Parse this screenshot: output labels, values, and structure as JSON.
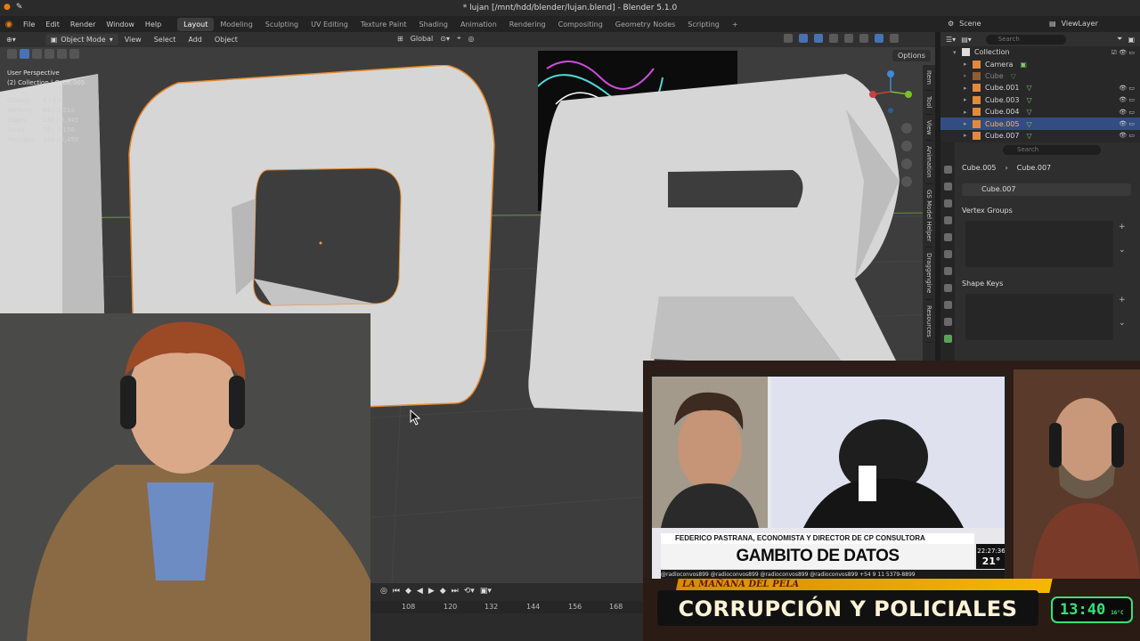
{
  "window": {
    "title": "* lujan [/mnt/hdd/blender/lujan.blend] - Blender 5.1.0"
  },
  "menubar": {
    "items": [
      "File",
      "Edit",
      "Render",
      "Window",
      "Help"
    ],
    "workspaces": [
      "Layout",
      "Modeling",
      "Sculpting",
      "UV Editing",
      "Texture Paint",
      "Shading",
      "Animation",
      "Rendering",
      "Compositing",
      "Geometry Nodes",
      "Scripting"
    ],
    "active_workspace": "Layout",
    "add_tab": "+",
    "scene": "Scene",
    "view_layer": "ViewLayer"
  },
  "viewport_header": {
    "mode": "Object Mode",
    "menus": [
      "View",
      "Select",
      "Add",
      "Object"
    ],
    "orientation": "Global",
    "options": "Options"
  },
  "viewport": {
    "perspective": "User Perspective",
    "collection_path": "(2) Collection | Cube.005",
    "stats": [
      {
        "label": "Objects",
        "value": "1 / 12"
      },
      {
        "label": "Vertices",
        "value": "64 / 1,214"
      },
      {
        "label": "Edges",
        "value": "136 / 2,345"
      },
      {
        "label": "Faces",
        "value": "72 / 1,150"
      },
      {
        "label": "Triangles",
        "value": "128 / 2,458"
      }
    ],
    "side_tabs": [
      "Item",
      "Tool",
      "View",
      "Animation",
      "GS Model Helper",
      "Draggengine",
      "Resources"
    ],
    "colors": {
      "background": "#3d3d3d",
      "selected_outline": "#e8892b",
      "mesh": "#dcdcdc"
    }
  },
  "timeline": {
    "ruler": [
      "108",
      "120",
      "132",
      "144",
      "156",
      "168"
    ]
  },
  "outliner": {
    "search_placeholder": "Search",
    "rows": [
      {
        "name": "Collection",
        "type": "collection",
        "selected": false
      },
      {
        "name": "Camera",
        "type": "camera",
        "selected": false
      },
      {
        "name": "Cube",
        "type": "mesh",
        "selected": false
      },
      {
        "name": "Cube.001",
        "type": "mesh",
        "selected": false
      },
      {
        "name": "Cube.003",
        "type": "mesh",
        "selected": false
      },
      {
        "name": "Cube.004",
        "type": "mesh",
        "selected": false
      },
      {
        "name": "Cube.005",
        "type": "mesh",
        "selected": true
      },
      {
        "name": "Cube.007",
        "type": "mesh",
        "selected": false
      }
    ]
  },
  "properties": {
    "search_placeholder": "Search",
    "breadcrumb_object": "Cube.005",
    "breadcrumb_mesh": "Cube.007",
    "mesh_name": "Cube.007",
    "panels": [
      "Vertex Groups",
      "Shape Keys"
    ]
  },
  "stream": {
    "tv_name_bar": "FEDERICO PASTRANA, ECONOMISTA Y DIRECTOR DE CP CONSULTORA",
    "tv_title": "GAMBITO DE DATOS",
    "tv_time": "22:27:36",
    "tv_temp": "21°",
    "tv_ticker": "@radioconvos899   @radioconvos899   @radioconvos899   @radioconvos899   +54 9 11 5379-8899",
    "banner_tag": "LA MAÑANA DEL PELA",
    "banner_title": "CORRUPCIÓN Y POLICIALES",
    "banner_clock": "13:40",
    "banner_clock_temp": "16°C"
  }
}
